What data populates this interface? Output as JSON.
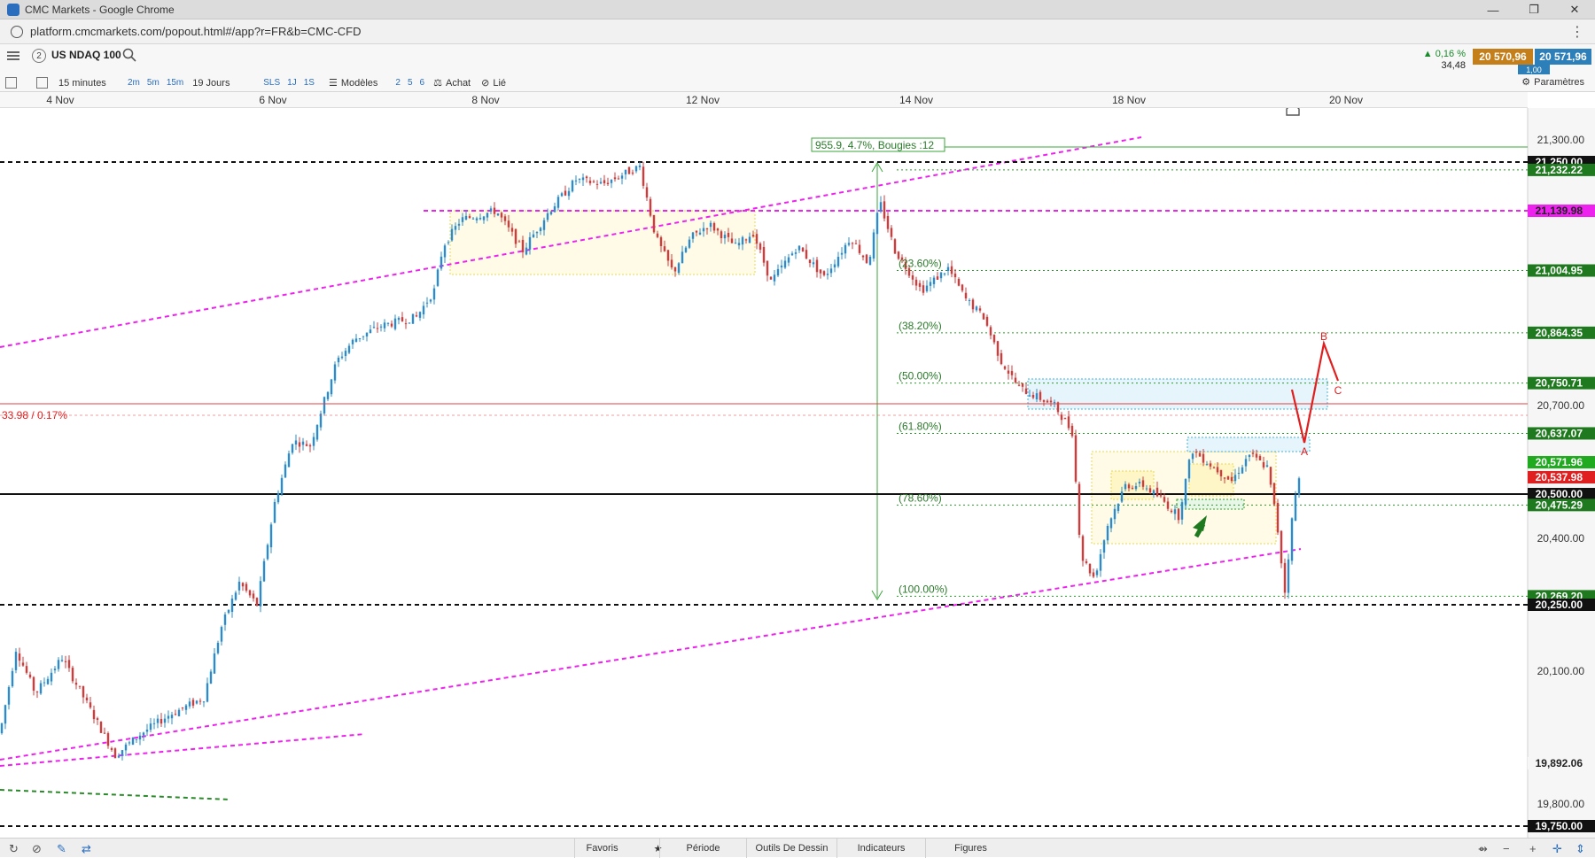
{
  "window": {
    "title": "CMC Markets - Google Chrome",
    "url": "platform.cmcmarkets.com/popout.html#/app?r=FR&b=CMC-CFD"
  },
  "instrument": {
    "count": "2",
    "name": "US NDAQ 100",
    "change_pct": "▲ 0,16 %",
    "change_pts": "34,48",
    "bid": "20 570,96",
    "ask": "20 571,96",
    "spread": "1,00"
  },
  "toolbar": {
    "interval": "15 minutes",
    "quick_intervals": [
      "2m",
      "5m",
      "15m"
    ],
    "range": "19 Jours",
    "chart_types": [
      "SLS",
      "1J",
      "1S"
    ],
    "models_label": "Modèles",
    "counts": [
      "2",
      "5",
      "6"
    ],
    "buy_label": "Achat",
    "link_label": "Lié",
    "settings_label": "Paramètres"
  },
  "bottom": {
    "tabs": [
      "Favoris",
      "Période",
      "Outils De Dessin",
      "Indicateurs",
      "Figures"
    ]
  },
  "chart_data": {
    "type": "candlestick",
    "x_ticks": [
      "4 Nov",
      "6 Nov",
      "8 Nov",
      "12 Nov",
      "14 Nov",
      "18 Nov",
      "20 Nov"
    ],
    "y_ticks": [
      "21,300.00",
      "20,700.00",
      "20,400.00",
      "20,100.00",
      "19,800.00"
    ],
    "y_range": [
      19700,
      21400
    ],
    "price_labels": [
      {
        "value": 21250.0,
        "text": "21,250.00",
        "style": "black"
      },
      {
        "value": 21232.22,
        "text": "21,232.22",
        "style": "green"
      },
      {
        "value": 21139.98,
        "text": "21,139.98",
        "style": "magenta"
      },
      {
        "value": 21004.95,
        "text": "21,004.95",
        "style": "green"
      },
      {
        "value": 20864.35,
        "text": "20,864.35",
        "style": "green"
      },
      {
        "value": 20750.71,
        "text": "20,750.71",
        "style": "green"
      },
      {
        "value": 20637.07,
        "text": "20,637.07",
        "style": "green"
      },
      {
        "value": 20571.96,
        "text": "20,571.96",
        "style": "solid-green"
      },
      {
        "value": 20537.98,
        "text": "20,537.98",
        "style": "red"
      },
      {
        "value": 20500.0,
        "text": "20,500.00",
        "style": "black"
      },
      {
        "value": 20475.29,
        "text": "20,475.29",
        "style": "green"
      },
      {
        "value": 20269.2,
        "text": "20,269.20",
        "style": "green"
      },
      {
        "value": 20250.0,
        "text": "20,250.00",
        "style": "black"
      },
      {
        "value": 19892.06,
        "text": "19,892.06",
        "style": "grey"
      },
      {
        "value": 19750.0,
        "text": "19,750.00",
        "style": "black"
      }
    ],
    "fib_levels": [
      {
        "value": 21004.95,
        "text": "(23.60%)"
      },
      {
        "value": 20864.35,
        "text": "(38.20%)"
      },
      {
        "value": 20750.71,
        "text": "(50.00%)"
      },
      {
        "value": 20637.07,
        "text": "(61.80%)"
      },
      {
        "value": 20475.29,
        "text": "(78.60%)"
      },
      {
        "value": 20269.2,
        "text": "(100.00%)"
      }
    ],
    "measure_label": "955.9, 4.7%, Bougies :12",
    "change_label": "33.98 / 0.17%",
    "wave_labels": [
      "A",
      "B",
      "C"
    ]
  }
}
